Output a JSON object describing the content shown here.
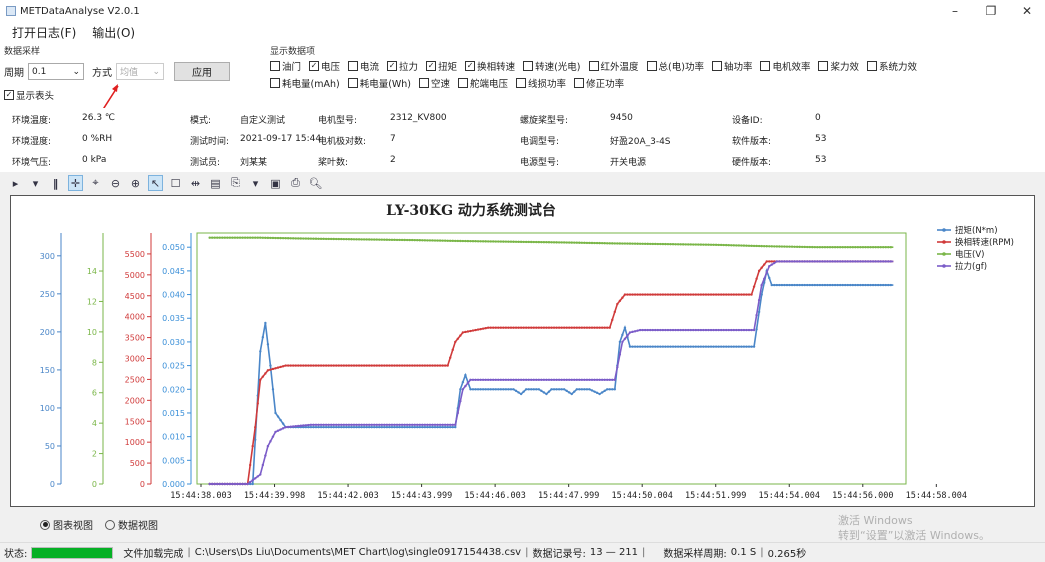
{
  "app": {
    "title": "METDataAnalyse V2.0.1"
  },
  "window": {
    "minimize": "–",
    "restore": "❐",
    "close": "✕"
  },
  "menu": [
    {
      "label": "打开日志(F)"
    },
    {
      "label": "输出(O)"
    }
  ],
  "sampling": {
    "group_label": "数据采样",
    "period_label": "周期",
    "period_value": "0.1",
    "mode_label": "方式",
    "mode_value": "均值",
    "apply_label": "应用",
    "show_header_label": "显示表头",
    "show_header_checked": true
  },
  "data_items": {
    "group_label": "显示数据项",
    "row1": [
      {
        "label": "油门",
        "checked": false
      },
      {
        "label": "电压",
        "checked": true
      },
      {
        "label": "电流",
        "checked": false
      },
      {
        "label": "拉力",
        "checked": true
      },
      {
        "label": "扭矩",
        "checked": true
      },
      {
        "label": "换相转速",
        "checked": true
      },
      {
        "label": "转速(光电)",
        "checked": false
      },
      {
        "label": "红外温度",
        "checked": false
      },
      {
        "label": "总(电)功率",
        "checked": false
      },
      {
        "label": "轴功率",
        "checked": false
      },
      {
        "label": "电机效率",
        "checked": false
      },
      {
        "label": "桨力效",
        "checked": false
      },
      {
        "label": "系统力效",
        "checked": false
      }
    ],
    "row2": [
      {
        "label": "耗电量(mAh)",
        "checked": false
      },
      {
        "label": "耗电量(Wh)",
        "checked": false
      },
      {
        "label": "空速",
        "checked": false
      },
      {
        "label": "舵端电压",
        "checked": false
      },
      {
        "label": "线损功率",
        "checked": false
      },
      {
        "label": "修正功率",
        "checked": false
      }
    ]
  },
  "info": {
    "rows": [
      [
        {
          "label": "环境温度:",
          "value": "26.3 ℃"
        },
        {
          "label": "模式:",
          "value": "自定义测试"
        },
        {
          "label": "电机型号:",
          "value": "2312_KV800"
        },
        {
          "label": "螺旋桨型号:",
          "value": "9450"
        },
        {
          "label": "设备ID:",
          "value": "0"
        }
      ],
      [
        {
          "label": "环境湿度:",
          "value": "0 %RH"
        },
        {
          "label": "测试时间:",
          "value": "2021-09-17 15:44"
        },
        {
          "label": "电机极对数:",
          "value": "7"
        },
        {
          "label": "电调型号:",
          "value": "好盈20A_3-4S"
        },
        {
          "label": "软件版本:",
          "value": "53"
        }
      ],
      [
        {
          "label": "环境气压:",
          "value": "0 kPa"
        },
        {
          "label": "测试员:",
          "value": "刘某某"
        },
        {
          "label": "桨叶数:",
          "value": "2"
        },
        {
          "label": "电源型号:",
          "value": "开关电源"
        },
        {
          "label": "硬件版本:",
          "value": "53"
        }
      ]
    ]
  },
  "toolbar_icons": [
    "play-icon",
    "dropdown-icon",
    "pause-icon",
    "pan-icon",
    "crosshair-icon",
    "zoom-out-icon",
    "zoom-in-icon",
    "select-icon",
    "box-select-icon",
    "fit-icon",
    "properties-icon",
    "copy-icon",
    "copy-dropdown-icon",
    "save-icon",
    "print-icon",
    "print-preview-icon"
  ],
  "chart_data": {
    "type": "line",
    "title": "LY-30KG 动力系统测试台",
    "x_ticks": [
      "15:44:38.003",
      "15:44:39.998",
      "15:44:42.003",
      "15:44:43.999",
      "15:44:46.003",
      "15:44:47.999",
      "15:44:50.004",
      "15:44:51.999",
      "15:44:54.004",
      "15:44:56.000",
      "15:44:58.004"
    ],
    "x_start_seconds": 0,
    "x_end_seconds": 20,
    "axes": [
      {
        "name": "torque",
        "range": [
          0,
          330
        ],
        "ticks": [
          0,
          50,
          100,
          150,
          200,
          250,
          300
        ],
        "color": "#4a86c8"
      },
      {
        "name": "voltage",
        "range": [
          0,
          16.5
        ],
        "ticks": [
          0,
          2,
          4,
          6,
          8,
          10,
          12,
          14
        ],
        "color": "#7ab648"
      },
      {
        "name": "rpm",
        "range": [
          0,
          6000
        ],
        "ticks": [
          0,
          500,
          1000,
          1500,
          2000,
          2500,
          3000,
          3500,
          4000,
          4500,
          5000,
          5500
        ],
        "color": "#d03a3a"
      },
      {
        "name": "thrust",
        "range": [
          0,
          0.053
        ],
        "ticks": [
          "0.000",
          "0.005",
          "0.010",
          "0.015",
          "0.020",
          "0.025",
          "0.030",
          "0.035",
          "0.040",
          "0.045",
          "0.050"
        ],
        "color": "#3a8fd8"
      }
    ],
    "legend": [
      {
        "label": "扭矩(N*m)",
        "color": "#4a86c8"
      },
      {
        "label": "换相转速(RPM)",
        "color": "#d03a3a"
      },
      {
        "label": "电压(V)",
        "color": "#7ab648"
      },
      {
        "label": "拉力(gf)",
        "color": "#7b5cc8"
      }
    ],
    "series": [
      {
        "name": "扭矩(N*m)",
        "color": "#4a86c8",
        "axis": "thrust",
        "points": [
          [
            0,
            0
          ],
          [
            1,
            0
          ],
          [
            1.7,
            0
          ],
          [
            2.0,
            0.028
          ],
          [
            2.2,
            0.034
          ],
          [
            2.4,
            0.025
          ],
          [
            2.6,
            0.015
          ],
          [
            3.0,
            0.012
          ],
          [
            4,
            0.012
          ],
          [
            6,
            0.012
          ],
          [
            8,
            0.012
          ],
          [
            9.7,
            0.012
          ],
          [
            9.9,
            0.02
          ],
          [
            10.1,
            0.023
          ],
          [
            10.3,
            0.02
          ],
          [
            11,
            0.02
          ],
          [
            12,
            0.02
          ],
          [
            12.3,
            0.019
          ],
          [
            12.5,
            0.02
          ],
          [
            13,
            0.02
          ],
          [
            13.3,
            0.019
          ],
          [
            13.5,
            0.02
          ],
          [
            14,
            0.02
          ],
          [
            14.3,
            0.019
          ],
          [
            14.5,
            0.02
          ],
          [
            15,
            0.02
          ],
          [
            15.4,
            0.019
          ],
          [
            15.7,
            0.02
          ],
          [
            16.0,
            0.02
          ],
          [
            16.2,
            0.03
          ],
          [
            16.4,
            0.033
          ],
          [
            16.6,
            0.029
          ],
          [
            17,
            0.029
          ],
          [
            19,
            0.029
          ],
          [
            21.5,
            0.029
          ],
          [
            21.8,
            0.04
          ],
          [
            22.0,
            0.045
          ],
          [
            22.2,
            0.042
          ],
          [
            23,
            0.042
          ],
          [
            25,
            0.042
          ],
          [
            27,
            0.042
          ]
        ]
      },
      {
        "name": "换相转速(RPM)",
        "color": "#d03a3a",
        "axis": "thrust",
        "points": [
          [
            0,
            0
          ],
          [
            1,
            0
          ],
          [
            1.5,
            0
          ],
          [
            1.8,
            0.012
          ],
          [
            2.0,
            0.022
          ],
          [
            2.3,
            0.024
          ],
          [
            3,
            0.025
          ],
          [
            4,
            0.025
          ],
          [
            6,
            0.025
          ],
          [
            8,
            0.025
          ],
          [
            9.4,
            0.025
          ],
          [
            9.7,
            0.03
          ],
          [
            10.0,
            0.032
          ],
          [
            11,
            0.033
          ],
          [
            13,
            0.033
          ],
          [
            15,
            0.033
          ],
          [
            15.8,
            0.033
          ],
          [
            16.1,
            0.038
          ],
          [
            16.4,
            0.04
          ],
          [
            17,
            0.04
          ],
          [
            19,
            0.04
          ],
          [
            21.4,
            0.04
          ],
          [
            21.7,
            0.045
          ],
          [
            22.0,
            0.047
          ],
          [
            23,
            0.047
          ],
          [
            25,
            0.047
          ],
          [
            27,
            0.047
          ]
        ]
      },
      {
        "name": "电压(V)",
        "color": "#7ab648",
        "axis": "thrust",
        "points": [
          [
            0,
            0.052
          ],
          [
            2,
            0.052
          ],
          [
            4,
            0.0518
          ],
          [
            8,
            0.0515
          ],
          [
            10,
            0.0513
          ],
          [
            14,
            0.051
          ],
          [
            16,
            0.0508
          ],
          [
            20,
            0.0505
          ],
          [
            22,
            0.0502
          ],
          [
            24,
            0.05
          ],
          [
            27,
            0.05
          ]
        ]
      },
      {
        "name": "拉力(gf)",
        "color": "#7b5cc8",
        "axis": "thrust",
        "points": [
          [
            0,
            0
          ],
          [
            1.5,
            0
          ],
          [
            2.0,
            0.002
          ],
          [
            2.3,
            0.008
          ],
          [
            2.6,
            0.011
          ],
          [
            3.0,
            0.012
          ],
          [
            4,
            0.0125
          ],
          [
            6,
            0.0125
          ],
          [
            8,
            0.0125
          ],
          [
            9.7,
            0.0125
          ],
          [
            10.0,
            0.02
          ],
          [
            10.3,
            0.022
          ],
          [
            11,
            0.022
          ],
          [
            13,
            0.022
          ],
          [
            15,
            0.022
          ],
          [
            16,
            0.022
          ],
          [
            16.3,
            0.03
          ],
          [
            16.6,
            0.032
          ],
          [
            17,
            0.0325
          ],
          [
            19,
            0.0325
          ],
          [
            21.5,
            0.0325
          ],
          [
            21.8,
            0.042
          ],
          [
            22.1,
            0.046
          ],
          [
            22.4,
            0.047
          ],
          [
            23,
            0.047
          ],
          [
            25,
            0.047
          ],
          [
            27,
            0.047
          ]
        ]
      }
    ],
    "x_domain": [
      -0.5,
      27.5
    ],
    "y_domain": [
      0,
      0.053
    ]
  },
  "view": {
    "chart_view_label": "图表视图",
    "data_view_label": "数据视图",
    "selected": "chart"
  },
  "watermark": {
    "line1": "激活 Windows",
    "line2": "转到“设置”以激活 Windows。"
  },
  "status": {
    "label": "状态:",
    "progress": 1.0,
    "progress_color": "#06b025",
    "message": "文件加载完成",
    "file_path": "C:\\Users\\Ds Liu\\Documents\\MET Chart\\log\\single0917154438.csv",
    "records_label": "数据记录号:",
    "records_value": "13 — 211",
    "period_label": "数据采样周期:",
    "period_value": "0.1 S",
    "elapsed": "0.265秒"
  }
}
